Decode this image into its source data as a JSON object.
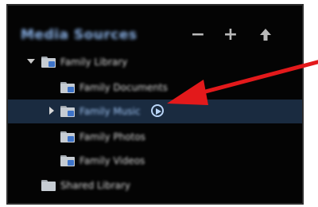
{
  "panel": {
    "title": "Media Sources",
    "remove_label": "−",
    "add_label": "+",
    "up_icon": "arrow-up-icon"
  },
  "tree": [
    {
      "label": "Family Library",
      "expanded": true,
      "selected": false,
      "icon": "folder-icon"
    },
    {
      "label": "Family Documents",
      "expanded": false,
      "selected": false,
      "icon": "folder-icon"
    },
    {
      "label": "Family Music",
      "expanded": false,
      "selected": true,
      "icon": "folder-icon",
      "action_icon": "play-circle-icon"
    },
    {
      "label": "Family Photos",
      "expanded": false,
      "selected": false,
      "icon": "folder-icon"
    },
    {
      "label": "Family Videos",
      "expanded": false,
      "selected": false,
      "icon": "folder-icon"
    },
    {
      "label": "Shared Library",
      "expanded": false,
      "selected": false,
      "icon": "folder-icon"
    }
  ],
  "colors": {
    "panel_bg": "#040404",
    "selection_bg": "#1a2b40",
    "annotation_red": "#e3191b",
    "title_blue": "#8ab1e6"
  }
}
